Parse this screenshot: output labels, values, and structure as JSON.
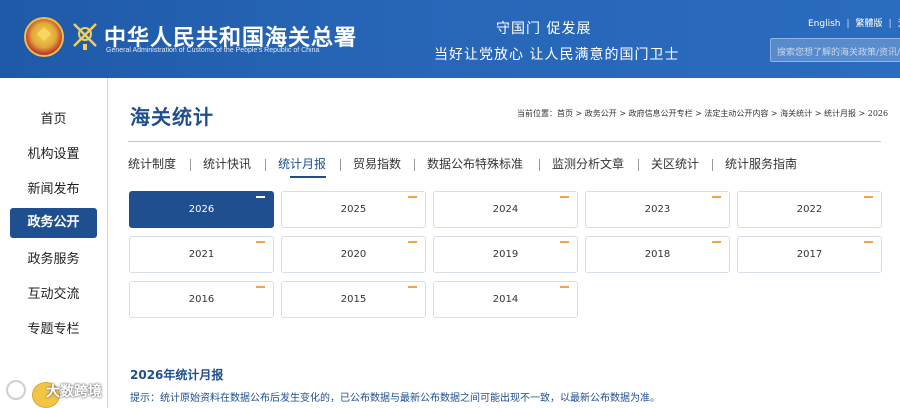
{
  "header": {
    "title_cn": "中华人民共和国海关总署",
    "title_en": "General Administration of Customs of the People's Republic of China",
    "motto_line1": "守国门 促发展",
    "motto_line2": "当好让党放心 让人民满意的国门卫士",
    "languages": [
      "English",
      "繁體版",
      "无"
    ],
    "search_placeholder": "搜索您想了解的海关政策/资讯/服务"
  },
  "sidebar": {
    "items": [
      {
        "label": "首页",
        "active": false
      },
      {
        "label": "机构设置",
        "active": false
      },
      {
        "label": "新闻发布",
        "active": false
      },
      {
        "label": "政务公开",
        "active": true
      },
      {
        "label": "政务服务",
        "active": false
      },
      {
        "label": "互动交流",
        "active": false
      },
      {
        "label": "专题专栏",
        "active": false
      }
    ]
  },
  "main": {
    "page_title": "海关统计",
    "breadcrumb": "当前位置：首页 > 政务公开 > 政府信息公开专栏 > 法定主动公开内容 > 海关统计 > 统计月报 > 2026",
    "tabs": [
      {
        "label": "统计制度",
        "active": false
      },
      {
        "label": "统计快讯",
        "active": false
      },
      {
        "label": "统计月报",
        "active": true
      },
      {
        "label": "贸易指数",
        "active": false
      },
      {
        "label": "数据公布特殊标准",
        "active": false
      },
      {
        "label": "监测分析文章",
        "active": false
      },
      {
        "label": "关区统计",
        "active": false
      },
      {
        "label": "统计服务指南",
        "active": false
      }
    ],
    "years": [
      "2026",
      "2025",
      "2024",
      "2023",
      "2022",
      "2021",
      "2020",
      "2019",
      "2018",
      "2017",
      "2016",
      "2015",
      "2014"
    ],
    "active_year": "2026",
    "section_title": "2026年统计月报",
    "notice": "提示：统计原始资料在数据公布后发生变化的，已公布数据与最新公布数据之间可能出现不一致，以最新公布数据为准。"
  },
  "watermark": {
    "text": "大数跨境"
  },
  "colors": {
    "header_blue": "#2766b7",
    "accent": "#1f4f8f",
    "card_corner": "#f2a24a"
  }
}
